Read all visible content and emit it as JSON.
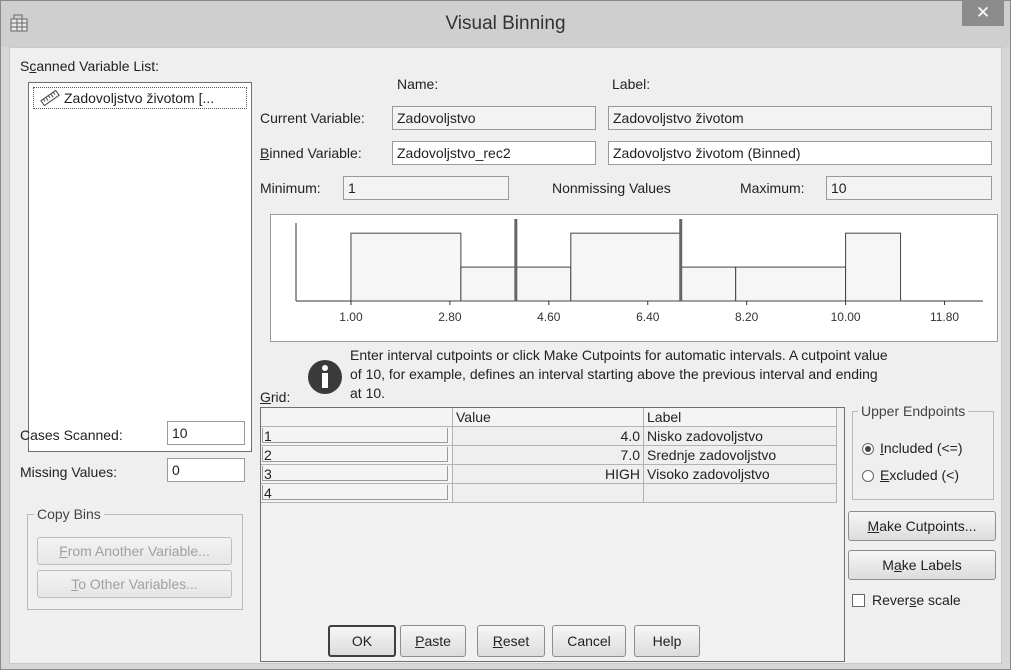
{
  "window": {
    "title": "Visual Binning",
    "close": "✕"
  },
  "scanned": {
    "label_pre": "S",
    "label_u": "c",
    "label_post": "anned Variable List:",
    "items": [
      "Zadovoljstvo životom [..."
    ]
  },
  "headers": {
    "name": "Name:",
    "label": "Label:"
  },
  "current": {
    "label": "Current Variable:",
    "name": "Zadovoljstvo",
    "varlabel": "Zadovoljstvo životom"
  },
  "binned": {
    "label_u": "B",
    "label_post": "inned Variable:",
    "name": "Zadovoljstvo_rec2",
    "varlabel": "Zadovoljstvo životom (Binned)"
  },
  "minimum": {
    "label": "Minimum:",
    "value": "1"
  },
  "nonmissing": "Nonmissing Values",
  "maximum": {
    "label": "Maximum:",
    "value": "10"
  },
  "cases": {
    "label": "Cases Scanned:",
    "value": "10"
  },
  "missing": {
    "label": "Missing Values:",
    "value": "0"
  },
  "copybins": {
    "title": "Copy Bins",
    "from_u": "F",
    "from_post": "rom Another Variable...",
    "to_u": "T",
    "to_post": "o Other Variables..."
  },
  "chart_data": {
    "type": "bar",
    "x": [
      1.0,
      2.8,
      4.6,
      6.4,
      8.2,
      10.0,
      11.8
    ],
    "xticks": [
      "1.00",
      "2.80",
      "4.60",
      "6.40",
      "8.20",
      "10.00",
      "11.80"
    ],
    "bins": [
      {
        "from": 1.0,
        "to": 3.0,
        "height": 2
      },
      {
        "from": 3.0,
        "to": 4.0,
        "height": 1
      },
      {
        "from": 4.0,
        "to": 5.0,
        "height": 1
      },
      {
        "from": 5.0,
        "to": 7.0,
        "height": 2
      },
      {
        "from": 7.0,
        "to": 8.0,
        "height": 1
      },
      {
        "from": 8.0,
        "to": 10.0,
        "height": 1
      },
      {
        "from": 10.0,
        "to": 11.0,
        "height": 2
      }
    ],
    "cutpoints": [
      4.0,
      7.0
    ],
    "xlim": [
      0.0,
      12.5
    ],
    "ylim": [
      0,
      2.3
    ]
  },
  "info": {
    "line1": "Enter interval cutpoints or click Make Cutpoints for automatic intervals. A cutpoint value",
    "line2": "of 10, for example, defines an interval starting above the previous interval and ending",
    "line3": "at 10."
  },
  "grid": {
    "label_u": "G",
    "label_post": "rid:",
    "columns": [
      "",
      "Value",
      "Label"
    ],
    "rows": [
      {
        "n": "1",
        "value": "4.0",
        "label": "Nisko zadovoljstvo"
      },
      {
        "n": "2",
        "value": "7.0",
        "label": "Srednje zadovoljstvo"
      },
      {
        "n": "3",
        "value": "HIGH",
        "label": "Visoko zadovoljstvo"
      },
      {
        "n": "4",
        "value": "",
        "label": ""
      }
    ]
  },
  "upper": {
    "title": "Upper Endpoints",
    "included_u": "I",
    "included_post": "ncluded (<=)",
    "excluded_u": "E",
    "excluded_post": "xcluded (<)"
  },
  "buttons": {
    "make_cut_u": "M",
    "make_cut_post": "ake Cutpoints...",
    "make_labels_pre": "M",
    "make_labels_u": "a",
    "make_labels_post": "ke Labels",
    "reverse_pre": "Rever",
    "reverse_u": "s",
    "reverse_post": "e scale",
    "ok": "OK",
    "paste_u": "P",
    "paste_post": "aste",
    "reset_u": "R",
    "reset_post": "eset",
    "cancel": "Cancel",
    "help": "Help"
  }
}
